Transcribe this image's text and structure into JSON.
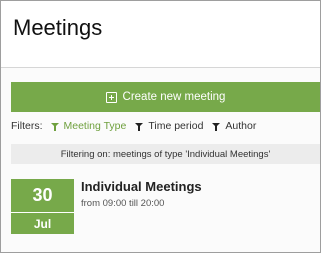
{
  "page": {
    "title": "Meetings"
  },
  "actions": {
    "create_label": "Create new meeting"
  },
  "filters": {
    "label": "Filters:",
    "items": [
      {
        "label": "Meeting Type",
        "active": true
      },
      {
        "label": "Time period",
        "active": false
      },
      {
        "label": "Author",
        "active": false
      }
    ],
    "status_text": "Filtering on: meetings of type 'Individual Meetings'"
  },
  "meetings": [
    {
      "day": "30",
      "month": "Jul",
      "title": "Individual Meetings",
      "time": "from 09:00 till 20:00"
    }
  ],
  "colors": {
    "accent": "#77a94a",
    "active_filter": "#6fa03e"
  },
  "icons": {
    "create": "plus-square-icon",
    "filter": "funnel-icon"
  }
}
